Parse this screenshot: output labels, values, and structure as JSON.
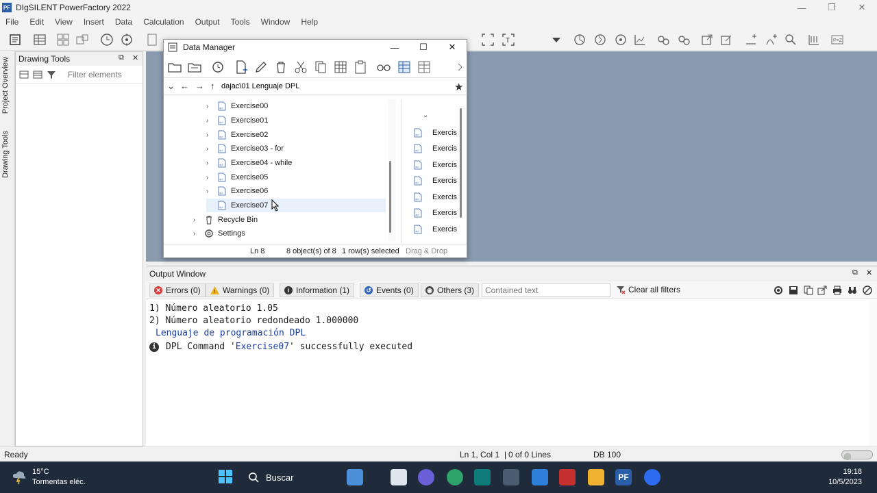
{
  "app": {
    "title": "DIgSILENT PowerFactory 2022",
    "logo": "PF",
    "controls": {
      "minimize": "—",
      "maximize": "❐",
      "close": "✕"
    }
  },
  "menu": [
    "File",
    "Edit",
    "View",
    "Insert",
    "Data",
    "Calculation",
    "Output",
    "Tools",
    "Window",
    "Help"
  ],
  "side_tabs": {
    "project_overview": "Project Overview",
    "drawing_tools": "Drawing Tools"
  },
  "drawing_tools": {
    "title": "Drawing Tools",
    "filter_placeholder": "Filter elements",
    "pin": "⧉",
    "close": "✕"
  },
  "data_manager": {
    "title": "Data Manager",
    "controls": {
      "minimize": "—",
      "maximize": "☐",
      "close": "✕"
    },
    "path": "dajac\\01 Lenguaje DPL",
    "tree": [
      {
        "label": "Exercise00",
        "expandable": true,
        "icon": "dpl-script-icon"
      },
      {
        "label": "Exercise01",
        "expandable": true,
        "icon": "dpl-script-icon"
      },
      {
        "label": "Exercise02",
        "expandable": true,
        "icon": "dpl-script-icon"
      },
      {
        "label": "Exercise03 - for",
        "expandable": true,
        "icon": "dpl-script-icon"
      },
      {
        "label": "Exercise04 - while",
        "expandable": true,
        "icon": "dpl-script-icon"
      },
      {
        "label": "Exercise05",
        "expandable": true,
        "icon": "dpl-script-icon"
      },
      {
        "label": "Exercise06",
        "expandable": true,
        "icon": "dpl-script-icon"
      },
      {
        "label": "Exercise07",
        "expandable": false,
        "icon": "dpl-script-icon"
      },
      {
        "label": "Recycle Bin",
        "expandable": true,
        "icon": "recycle-bin-icon"
      },
      {
        "label": "Settings",
        "expandable": true,
        "icon": "settings-icon"
      }
    ],
    "list_items": [
      "Exercis",
      "Exercis",
      "Exercis",
      "Exercis",
      "Exercis",
      "Exercis",
      "Exercis"
    ],
    "status": {
      "line": "Ln 8",
      "objects": "8 object(s) of 8",
      "rows": "1 row(s) selected",
      "drag": "Drag & Drop"
    }
  },
  "output": {
    "title": "Output Window",
    "pin": "⧉",
    "close": "✕",
    "filters": {
      "errors": "Errors (0)",
      "warnings": "Warnings (0)",
      "information": "Information (1)",
      "events": "Events (0)",
      "others": "Others (3)",
      "contained_placeholder": "Contained text",
      "clear": "Clear all filters"
    },
    "lines": {
      "l1": "1) Número aleatorio 1.05",
      "l2": "2) Número aleatorio redondeado 1.000000",
      "l3": "Lenguaje de programación DPL",
      "l4_prefix": "DPL Command '",
      "l4_name": "Exercise07",
      "l4_suffix": "' successfully executed"
    }
  },
  "status_bar": {
    "ready": "Ready",
    "position": "Ln 1, Col 1",
    "lines": "0 of 0 Lines",
    "db": "DB 100"
  },
  "taskbar": {
    "temperature": "15°C",
    "weather": "Tormentas eléc.",
    "search": "Buscar",
    "time": "19:18",
    "date": "10/5/2023"
  },
  "colors": {
    "canvas": "#8a9bb0",
    "taskbar": "#1f2b3a",
    "selection": "#e8f0fb",
    "output_blue": "#1a3c9c"
  }
}
